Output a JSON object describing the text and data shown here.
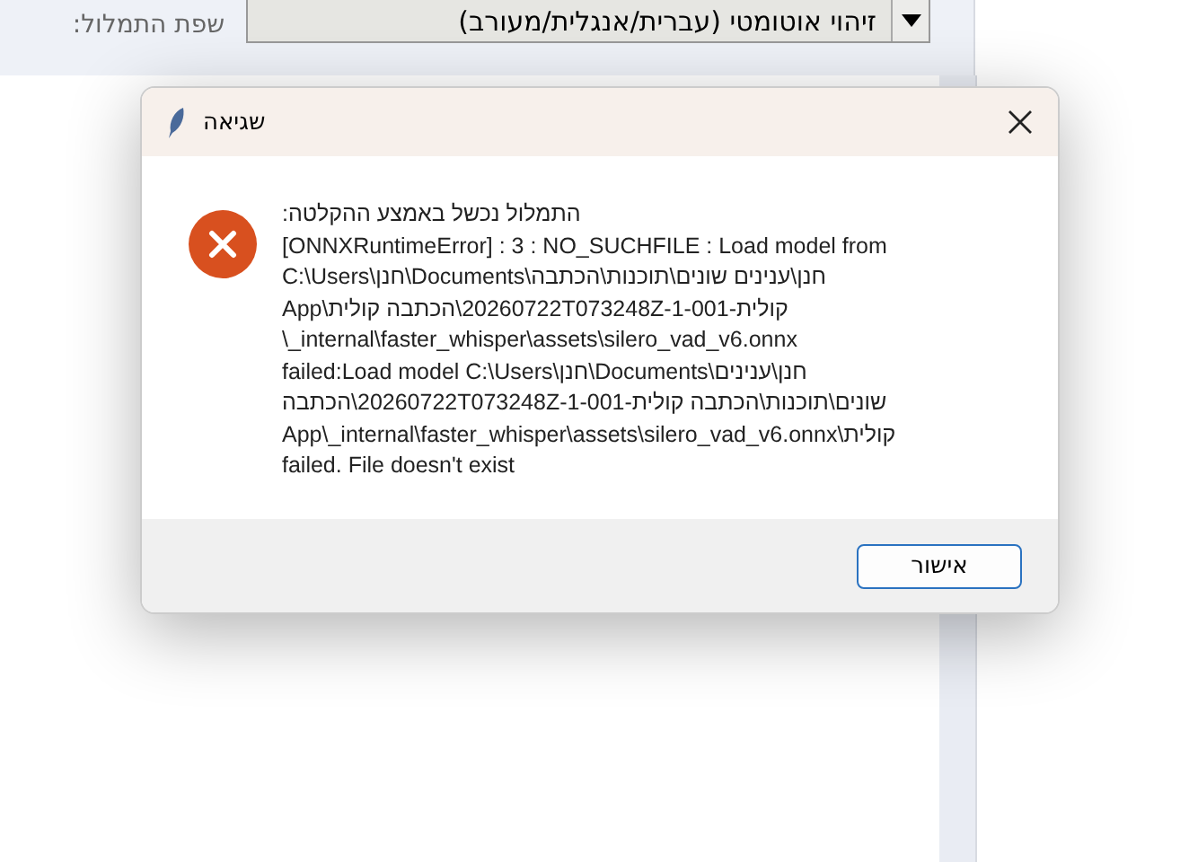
{
  "background_window": {
    "language_label": "שפת התמלול:",
    "language_combo": {
      "value": "זיהוי אוטומטי (עברית/אנגלית/מעורב)"
    }
  },
  "dialog": {
    "title": "שגיאה",
    "message_lines": [
      "התמלול נכשל באמצע ההקלטה:",
      "[ONNXRuntimeError] : 3 : NO_SUCHFILE : Load model from",
      "C:\\Users\\חנן\\Documents\\חנן\\ענינים שונים\\תוכנות\\הכתבה",
      "קולית-20260722T073248Z-1-001\\הכתבה קולית\\App",
      "\\_internal\\faster_whisper\\assets\\silero_vad_v6.onnx",
      "failed:Load model C:\\Users\\חנן\\Documents\\חנן\\ענינים",
      "שונים\\תוכנות\\הכתבה קולית-20260722T073248Z-1-001\\הכתבה",
      "קולית\\App\\_internal\\faster_whisper\\assets\\silero_vad_v6.onnx",
      "failed. File doesn't exist"
    ],
    "buttons": [
      "אישור"
    ]
  }
}
